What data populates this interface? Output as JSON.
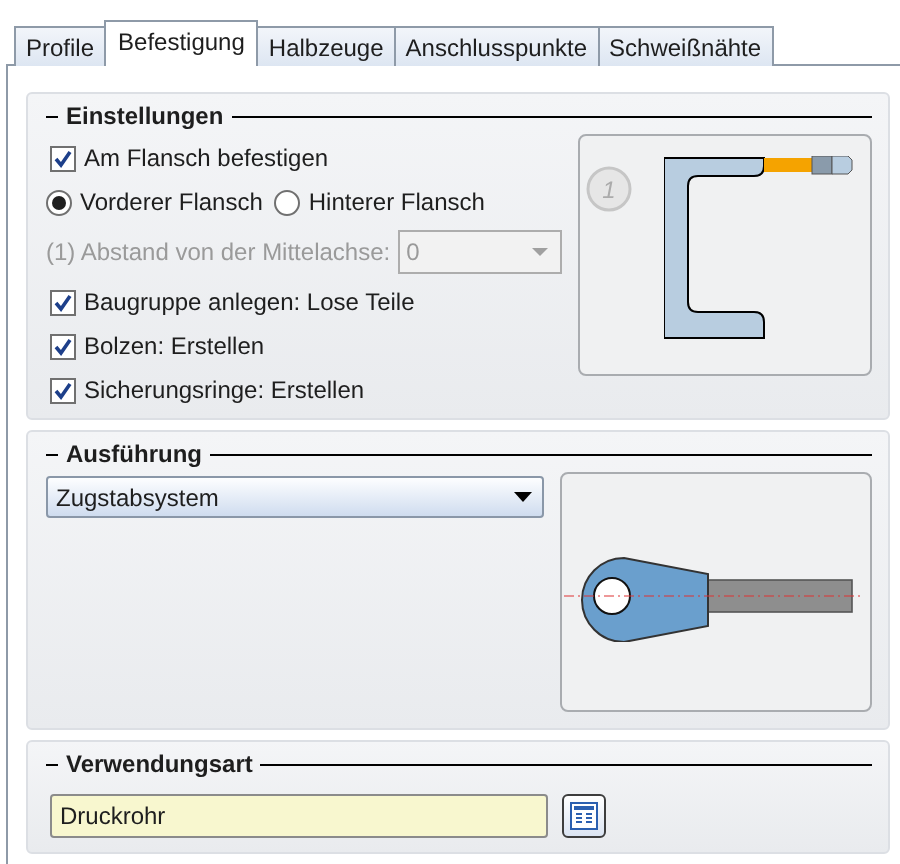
{
  "tabs": [
    {
      "label": "Profile",
      "selected": false
    },
    {
      "label": "Befestigung",
      "selected": true
    },
    {
      "label": "Halbzeuge",
      "selected": false
    },
    {
      "label": "Anschlusspunkte",
      "selected": false
    },
    {
      "label": "Schweißnähte",
      "selected": false
    }
  ],
  "einstellungen": {
    "title": "Einstellungen",
    "items": [
      {
        "kind": "checkbox",
        "label": "Am Flansch befestigen",
        "checked": true
      },
      {
        "kind": "radios",
        "options": [
          {
            "label": "Vorderer Flansch",
            "selected": true
          },
          {
            "label": "Hinterer Flansch",
            "selected": false
          }
        ]
      },
      {
        "kind": "combo",
        "label": "(1) Abstand von der Mittelachse:",
        "value": "0",
        "disabled": true
      },
      {
        "kind": "checkbox",
        "label": "Baugruppe anlegen: Lose Teile",
        "checked": true
      },
      {
        "kind": "checkbox",
        "label": "Bolzen: Erstellen",
        "checked": true
      },
      {
        "kind": "checkbox",
        "label": "Sicherungsringe: Erstellen",
        "checked": true
      }
    ],
    "diagram": {
      "marker": "1"
    }
  },
  "ausfuehrung": {
    "title": "Ausführung",
    "dropdown": {
      "value": "Zugstabsystem"
    }
  },
  "verwendungsart": {
    "title": "Verwendungsart",
    "field": {
      "value": "Druckrohr"
    }
  }
}
